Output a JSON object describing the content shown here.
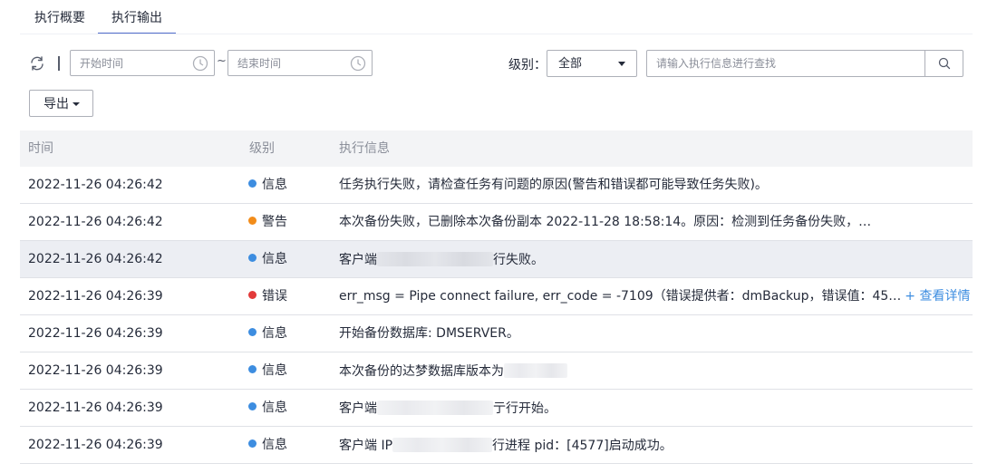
{
  "tabs": [
    {
      "label": "执行概要"
    },
    {
      "label": "执行输出"
    }
  ],
  "filters": {
    "start_placeholder": "开始时间",
    "end_placeholder": "结束时间",
    "separator": "~",
    "level_label": "级别：",
    "level_value": "全部",
    "search_placeholder": "请输入执行信息进行查找"
  },
  "export": {
    "label": "导出"
  },
  "table": {
    "headers": [
      "时间",
      "级别",
      "执行信息"
    ],
    "rows": [
      {
        "time": "2022-11-26 04:26:42",
        "level": "信息",
        "pre": "任务执行失败，请检查任务有问题的原因(警告和错误都可能导致任务失败)。",
        "post": "",
        "link": ""
      },
      {
        "time": "2022-11-26 04:26:42",
        "level": "警告",
        "pre": "本次备份失败，已删除本次备份副本 2022-11-28 18:58:14。原因：检测到任务备份失败，…",
        "post": "",
        "link": ""
      },
      {
        "time": "2022-11-26 04:26:42",
        "level": "信息",
        "pre": "客户端",
        "post": "行失败。",
        "link": ""
      },
      {
        "time": "2022-11-26 04:26:39",
        "level": "错误",
        "pre": "err_msg = Pipe connect failure, err_code = -7109（错误提供者：dmBackup，错误值：45…",
        "post": "",
        "link": "+ 查看详情"
      },
      {
        "time": "2022-11-26 04:26:39",
        "level": "信息",
        "pre": "开始备份数据库: DMSERVER。",
        "post": "",
        "link": ""
      },
      {
        "time": "2022-11-26 04:26:39",
        "level": "信息",
        "pre": "本次备份的达梦数据库版本为",
        "post": "",
        "link": ""
      },
      {
        "time": "2022-11-26 04:26:39",
        "level": "信息",
        "pre": "客户端",
        "post": "亍行开始。",
        "link": ""
      },
      {
        "time": "2022-11-26 04:26:39",
        "level": "信息",
        "pre": "客户端 IP",
        "post": "行进程 pid：[4577]启动成功。",
        "link": ""
      }
    ]
  },
  "colors": {
    "info": "#3d8de0",
    "warning": "#f28c1a",
    "error": "#e23a3a",
    "accent": "#526ecc"
  }
}
